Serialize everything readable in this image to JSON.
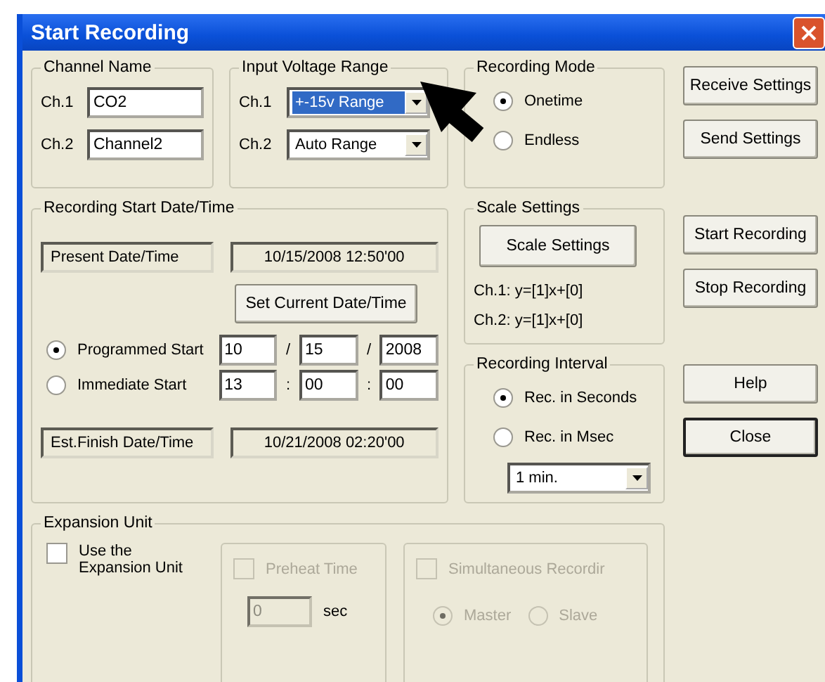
{
  "window": {
    "title": "Start Recording"
  },
  "channel_name": {
    "title": "Channel Name",
    "channels": [
      {
        "label": "Ch.1",
        "value": "CO2"
      },
      {
        "label": "Ch.2",
        "value": "Channel2"
      }
    ]
  },
  "input_voltage_range": {
    "title": "Input Voltage Range",
    "channels": [
      {
        "label": "Ch.1",
        "value": "+-15v Range",
        "highlighted": true
      },
      {
        "label": "Ch.2",
        "value": "Auto Range",
        "highlighted": false
      }
    ]
  },
  "recording_mode": {
    "title": "Recording Mode",
    "options": [
      {
        "label": "Onetime",
        "selected": true
      },
      {
        "label": "Endless",
        "selected": false
      }
    ]
  },
  "start_date_time": {
    "title": "Recording Start Date/Time",
    "present": {
      "label": "Present Date/Time",
      "value": "10/15/2008 12:50'00"
    },
    "set_button": "Set Current Date/Time",
    "options": [
      {
        "label": "Programmed Start",
        "selected": true,
        "fields": [
          "10",
          "15",
          "2008"
        ],
        "separators": [
          "/",
          "/"
        ]
      },
      {
        "label": "Immediate Start",
        "selected": false,
        "fields": [
          "13",
          "00",
          "00"
        ],
        "separators": [
          ":",
          ":"
        ]
      }
    ],
    "finish": {
      "label": "Est.Finish Date/Time",
      "value": "10/21/2008 02:20'00"
    }
  },
  "scale_settings": {
    "title": "Scale Settings",
    "button": "Scale Settings",
    "lines": [
      "Ch.1: y=[1]x+[0]",
      "Ch.2: y=[1]x+[0]"
    ]
  },
  "recording_interval": {
    "title": "Recording Interval",
    "options": [
      {
        "label": "Rec. in Seconds",
        "selected": true
      },
      {
        "label": "Rec. in Msec",
        "selected": false
      }
    ],
    "interval": "1 min."
  },
  "expansion_unit": {
    "title": "Expansion Unit",
    "use": {
      "label": "Use the Expansion Unit",
      "checked": false
    },
    "preheat": {
      "label": "Preheat Time",
      "checked": false,
      "disabled": true,
      "value": "0",
      "unit": "sec"
    },
    "simultaneous": {
      "label": "Simultaneous Recordir",
      "checked": false,
      "disabled": true,
      "options": [
        {
          "label": "Master",
          "selected": true
        },
        {
          "label": "Slave",
          "selected": false
        }
      ]
    }
  },
  "button_groups": [
    [
      {
        "label": "Receive Settings",
        "default": false
      },
      {
        "label": "Send Settings",
        "default": false
      }
    ],
    [
      {
        "label": "Start Recording",
        "default": false
      },
      {
        "label": "Stop Recording",
        "default": false
      }
    ],
    [
      {
        "label": "Help",
        "default": false
      },
      {
        "label": "Close",
        "default": true
      }
    ]
  ]
}
